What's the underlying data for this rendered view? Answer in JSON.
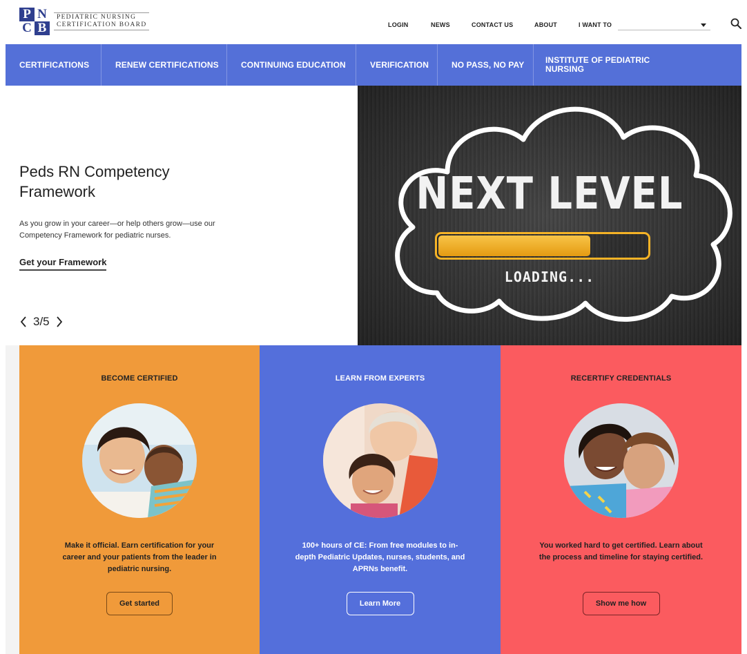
{
  "header": {
    "logo_letters": [
      "P",
      "N",
      "C",
      "B"
    ],
    "logo_line1": "PEDIATRIC NURSING",
    "logo_line2": "CERTIFICATION BOARD",
    "links": {
      "login": "LOGIN",
      "news": "NEWS",
      "contact": "CONTACT US",
      "about": "ABOUT",
      "i_want_to": "I WANT TO"
    },
    "icons": {
      "search": "search-icon",
      "dropdown": "chevron-down-icon"
    }
  },
  "nav": {
    "items": [
      "CERTIFICATIONS",
      "RENEW CERTIFICATIONS",
      "CONTINUING EDUCATION",
      "VERIFICATION",
      "NO PASS, NO PAY",
      "INSTITUTE OF PEDIATRIC NURSING"
    ]
  },
  "hero": {
    "title": "Peds RN Competency Framework",
    "description": "As you grow in your career—or help others grow—use our Competency Framework for pediatric nurses.",
    "link": "Get your Framework",
    "slide_counter": "3/5",
    "image_text_main": "NEXT LEVEL",
    "image_text_sub": "LOADING...",
    "loading_progress": 0.72,
    "colors": {
      "bar": "#f5b326"
    }
  },
  "cards": [
    {
      "title": "BECOME CERTIFIED",
      "text": "Make it official. Earn certification for your career and your patients from the leader in pediatric nursing.",
      "button": "Get started",
      "color": "#f09a3a"
    },
    {
      "title": "LEARN FROM EXPERTS",
      "text": "100+ hours of CE: From free modules to in-depth Pediatric Updates, nurses, students, and APRNs benefit.",
      "button": "Learn More",
      "color": "#546fdb"
    },
    {
      "title": "RECERTIFY CREDENTIALS",
      "text": "You worked hard to get certified. Learn about the process and timeline for staying certified.",
      "button": "Show me how",
      "color": "#fb5b5f"
    }
  ],
  "colors": {
    "nav": "#5470d8",
    "accent_blue": "#2f3f8f"
  }
}
